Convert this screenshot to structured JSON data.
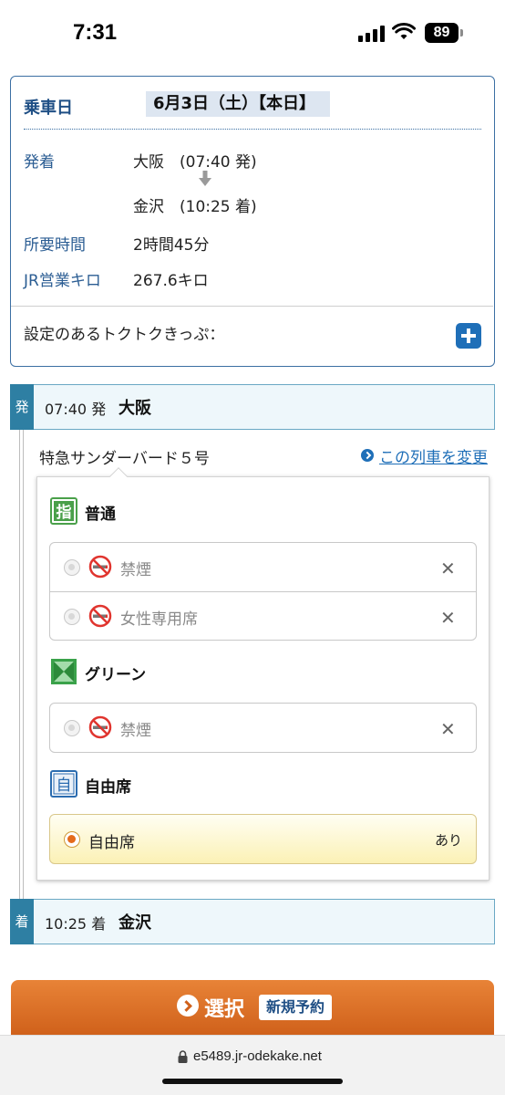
{
  "status_bar": {
    "time": "7:31",
    "battery": "89"
  },
  "info": {
    "date_label": "乗車日",
    "date_value": "6月3日（土）【本日】",
    "dep_arr_label": "発着",
    "departure": "大阪　(07:40 発)",
    "arrival": "金沢　(10:25 着)",
    "duration_label": "所要時間",
    "duration_value": "2時間45分",
    "distance_label": "JR営業キロ",
    "distance_value": "267.6キロ",
    "discount_label": "設定のあるトクトクきっぷ："
  },
  "timeline": {
    "dep_tag": "発",
    "dep_time": "07:40 発",
    "dep_station": "大阪",
    "train_name": "特急サンダーバード５号",
    "change_link": "この列車を変更",
    "arr_tag": "着",
    "arr_time": "10:25 着",
    "arr_station": "金沢"
  },
  "seat_classes": {
    "reserved": {
      "icon_text": "指",
      "label": "普通",
      "options": [
        {
          "label": "禁煙",
          "status": "✕"
        },
        {
          "label": "女性専用席",
          "status": "✕"
        }
      ]
    },
    "green": {
      "label": "グリーン",
      "options": [
        {
          "label": "禁煙",
          "status": "✕"
        }
      ]
    },
    "free": {
      "icon_text": "自",
      "label": "自由席",
      "option_label": "自由席",
      "availability": "あり"
    }
  },
  "select_button": {
    "label": "選択",
    "badge": "新規予約"
  },
  "browser": {
    "url": "e5489.jr-odekake.net"
  },
  "colors": {
    "accent_blue": "#1f6fb8",
    "orange": "#d0611b",
    "green": "#3aa24a",
    "teal": "#2e7fa3"
  }
}
